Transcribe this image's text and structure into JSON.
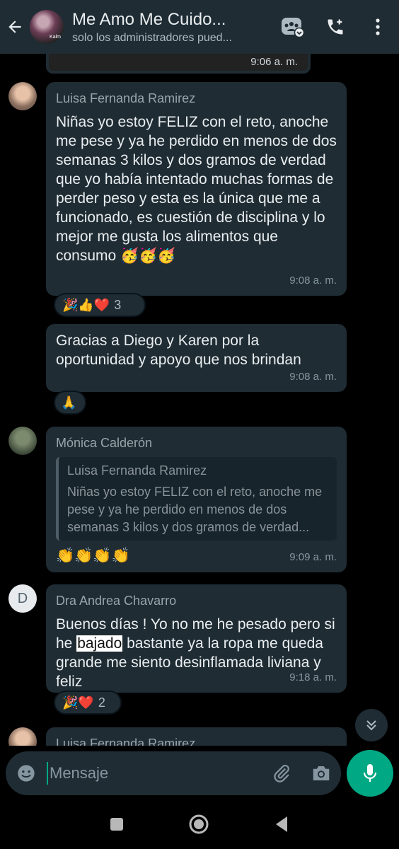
{
  "header": {
    "title": "Me Amo Me Cuido...",
    "subtitle": "solo los administradores pued...",
    "avatar_caption": "Kalm",
    "icons": [
      "back-arrow-icon",
      "community-icon",
      "add-call-icon",
      "more-vert-icon"
    ]
  },
  "messages": [
    {
      "time": "9:06 a. m."
    },
    {
      "sender": "Luisa Fernanda Ramirez",
      "text": "Niñas yo estoy FELIZ con el reto, anoche me pese y ya he perdido en menos de dos semanas 3 kilos y dos gramos de verdad que yo había intentado muchas formas de perder peso y esta es la única que me a funcionado, es cuestión de disciplina y lo mejor me gusta los alimentos que consumo",
      "emojis": "🥳🥳🥳",
      "time": "9:08 a. m.",
      "reactions": {
        "emojis": "🎉👍❤️",
        "count": "3"
      }
    },
    {
      "text": "Gracias a Diego y Karen por la oportunidad y apoyo que nos brindan",
      "time": "9:08 a. m.",
      "reactions": {
        "emojis": "🙏"
      }
    },
    {
      "sender": "Mónica Calderón",
      "quote": {
        "name": "Luisa Fernanda Ramirez",
        "text": "Niñas yo estoy FELIZ con el reto, anoche me pese y ya he perdido en menos de dos semanas 3 kilos y dos gramos de verdad..."
      },
      "text": "👏👏👏👏",
      "time": "9:09 a. m."
    },
    {
      "sender": "Dra Andrea Chavarro",
      "avatar_letter": "D",
      "text_before": "Buenos días ! Yo no me he pesado pero si he ",
      "highlight": "bajado",
      "text_after": " bastante ya la ropa me queda grande me siento desinflamada liviana y feliz",
      "time": "9:18 a. m.",
      "reactions": {
        "emojis": "🎉❤️",
        "count": "2"
      }
    },
    {
      "sender": "Luisa Fernanda Ramirez"
    }
  ],
  "input": {
    "placeholder": "Mensaje"
  },
  "colors": {
    "accent": "#00a884",
    "bubble": "#1f2c34",
    "header": "#1f2c34",
    "background": "#000000"
  }
}
